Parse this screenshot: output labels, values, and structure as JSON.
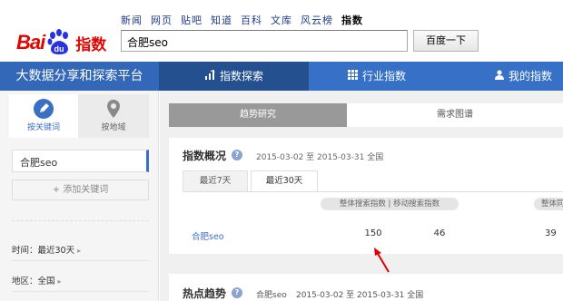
{
  "brand": {
    "logo_bai": "Bai",
    "logo_zhishu": "指数",
    "logo_paw_text": "du"
  },
  "topnav": [
    "新闻",
    "网页",
    "贴吧",
    "知道",
    "百科",
    "文库",
    "风云榜",
    "指数"
  ],
  "search": {
    "value": "合肥seo",
    "button": "百度一下"
  },
  "navbar": {
    "title": "大数据分享和探索平台",
    "items": [
      {
        "label": "指数探索",
        "icon": "trend-up-icon",
        "active": true
      },
      {
        "label": "行业指数",
        "icon": "grid-icon",
        "active": false
      },
      {
        "label": "我的指数",
        "icon": "user-icon",
        "active": false
      }
    ]
  },
  "sidebar": {
    "tab_keyword": "按关键词",
    "tab_area": "按地域",
    "keyword": "合肥seo",
    "add_keyword": "+ 添加关键词",
    "time_filter": "时间：最近30天",
    "region_filter": "地区：全国"
  },
  "main": {
    "tabs": [
      "趋势研究",
      "需求图谱"
    ],
    "overview": {
      "title": "指数概况",
      "date_range": "2015-03-02 至 2015-03-31   全国",
      "range_tabs": [
        "最近7天",
        "最近30天"
      ],
      "col_header": "整体搜索指数 | 移动搜索指数",
      "col_header_2": "整体同",
      "row": {
        "keyword": "合肥seo",
        "overall": "150",
        "mobile": "46",
        "third": "39"
      }
    },
    "hot_trend": {
      "title": "热点趋势",
      "keyword": "合肥seo",
      "date_range": "2015-03-02 至 2015-03-31   全国"
    }
  },
  "colors": {
    "brand_red": "#e10602",
    "nav_blue": "#3671c7",
    "accent_blue": "#3a6fc4",
    "annotation_red": "#e00000"
  }
}
